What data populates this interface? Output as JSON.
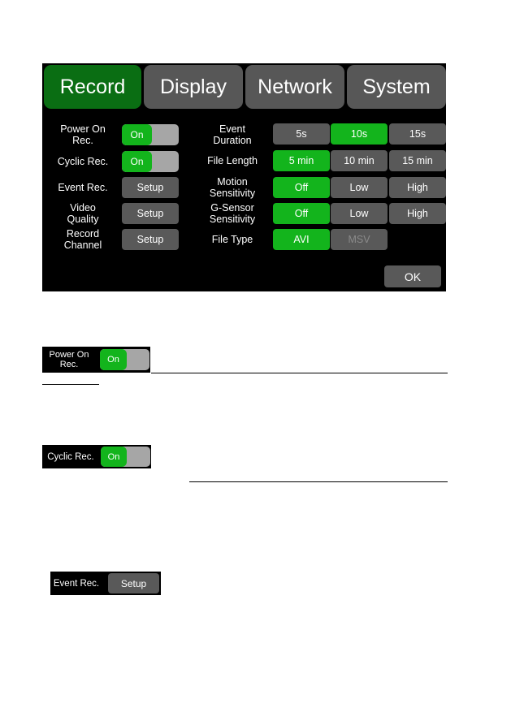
{
  "tabs": [
    {
      "label": "Record",
      "active": true
    },
    {
      "label": "Display",
      "active": false
    },
    {
      "label": "Network",
      "active": false
    },
    {
      "label": "System",
      "active": false
    }
  ],
  "left_settings": {
    "power_on_rec": {
      "label": "Power On Rec.",
      "label_lines": [
        "Power On",
        "Rec."
      ],
      "toggle": "On"
    },
    "cyclic_rec": {
      "label": "Cyclic Rec.",
      "toggle": "On"
    },
    "event_rec": {
      "label": "Event Rec.",
      "button": "Setup"
    },
    "video_quality": {
      "label_lines": [
        "Video",
        "Quality"
      ],
      "button": "Setup"
    },
    "record_channel": {
      "label_lines": [
        "Record",
        "Channel"
      ],
      "button": "Setup"
    }
  },
  "right_settings": {
    "event_duration": {
      "label_lines": [
        "Event",
        "Duration"
      ],
      "options": [
        "5s",
        "10s",
        "15s"
      ],
      "selected": "10s"
    },
    "file_length": {
      "label": "File Length",
      "options": [
        "5 min",
        "10 min",
        "15 min"
      ],
      "selected": "5 min"
    },
    "motion_sensitivity": {
      "label_lines": [
        "Motion",
        "Sensitivity"
      ],
      "options": [
        "Off",
        "Low",
        "High"
      ],
      "selected": "Off"
    },
    "gsensor_sensitivity": {
      "label_lines": [
        "G-Sensor",
        "Sensitivity"
      ],
      "options": [
        "Off",
        "Low",
        "High"
      ],
      "selected": "Off"
    },
    "file_type": {
      "label": "File Type",
      "options": [
        "AVI",
        "MSV"
      ],
      "selected": "AVI",
      "disabled": [
        "MSV"
      ]
    }
  },
  "ok_label": "OK",
  "snippets": {
    "power_on": {
      "label_lines": [
        "Power On",
        "Rec."
      ],
      "toggle": "On"
    },
    "cyclic": {
      "label": "Cyclic Rec.",
      "toggle": "On"
    },
    "event": {
      "label": "Event Rec.",
      "button": "Setup"
    }
  },
  "colors": {
    "active_tab": "#0a6e13",
    "selected": "#13b41c",
    "button": "#595959",
    "toggle_off": "#a6a6a6"
  }
}
